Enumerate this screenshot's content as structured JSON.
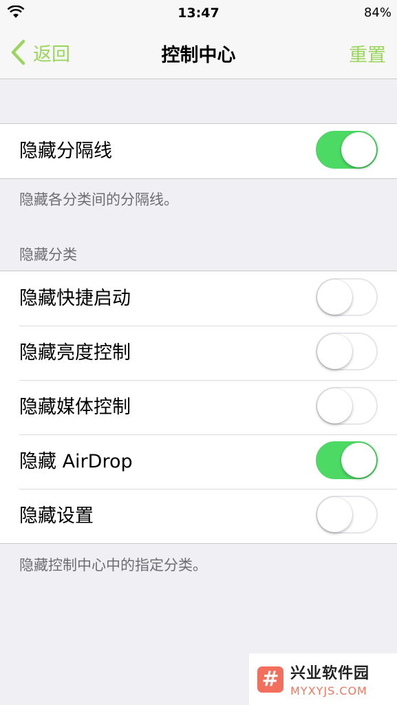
{
  "status": {
    "time": "13:47",
    "battery": "84%"
  },
  "nav": {
    "back_label": "返回",
    "title": "控制中心",
    "reset_label": "重置"
  },
  "separator_group": {
    "rows": [
      {
        "label": "隐藏分隔线",
        "on": true
      }
    ],
    "footer": "隐藏各分类间的分隔线。"
  },
  "categories_group": {
    "header": "隐藏分类",
    "rows": [
      {
        "label": "隐藏快捷启动",
        "on": false
      },
      {
        "label": "隐藏亮度控制",
        "on": false
      },
      {
        "label": "隐藏媒体控制",
        "on": false
      },
      {
        "label": "隐藏 AirDrop",
        "on": true
      },
      {
        "label": "隐藏设置",
        "on": false
      }
    ],
    "footer": "隐藏控制中心中的指定分类。"
  },
  "watermark": {
    "logo": "#",
    "title": "兴业软件园",
    "url": "MYXYJS.COM"
  },
  "colors": {
    "accent": "#9bd65c",
    "toggle_on": "#4cd964"
  },
  "icons": {
    "wifi": "wifi-icon",
    "back": "chevron-left-icon"
  }
}
